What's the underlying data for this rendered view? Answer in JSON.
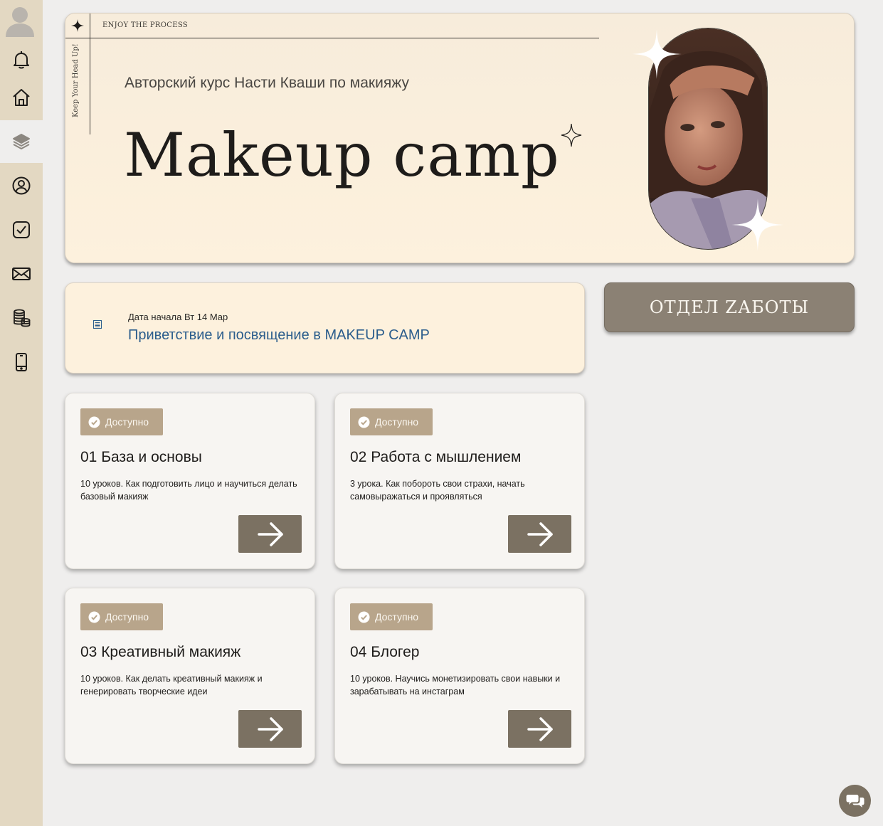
{
  "sidebar": {
    "items": [
      {
        "name": "bell-icon"
      },
      {
        "name": "home-icon"
      },
      {
        "name": "layers-icon",
        "active": true
      },
      {
        "name": "user-circle-icon"
      },
      {
        "name": "checkbox-icon"
      },
      {
        "name": "mail-icon"
      },
      {
        "name": "coins-icon"
      },
      {
        "name": "phone-icon"
      }
    ]
  },
  "hero": {
    "tagline": "ENJOY THE PROCESS",
    "vertical_text": "Keep Your Head Up!",
    "subtitle": "Авторский курс Насти Кваши по макияжу",
    "title": "Makeup camp"
  },
  "info": {
    "date": "Дата начала Вт 14 Мар",
    "link": "Приветствие и посвящение в MAKEUP CAMP"
  },
  "care_button": "OTДЕЛ ZАБОТЫ",
  "modules": [
    {
      "badge": "Доступно",
      "title": "01 База и основы",
      "desc": "10 уроков. Как подготовить лицо и научиться делать базовый макияж"
    },
    {
      "badge": "Доступно",
      "title": "02 Работа с мышлением",
      "desc": "3 урока. Как побороть свои страхи, начать самовыражаться и проявляться"
    },
    {
      "badge": "Доступно",
      "title": "03 Креативный макияж",
      "desc": "10 уроков. Как делать креативный макияж и генерировать творческие идеи"
    },
    {
      "badge": "Доступно",
      "title": "04 Блогер",
      "desc": "10 уроков. Научись монетизировать свои навыки и зарабатывать на инстаграм"
    }
  ],
  "colors": {
    "sidebar": "#e3d8c2",
    "hero_bg": "#fdf1dd",
    "accent": "#7b7162",
    "badge": "#b8a58b",
    "link": "#2b5d8c"
  }
}
